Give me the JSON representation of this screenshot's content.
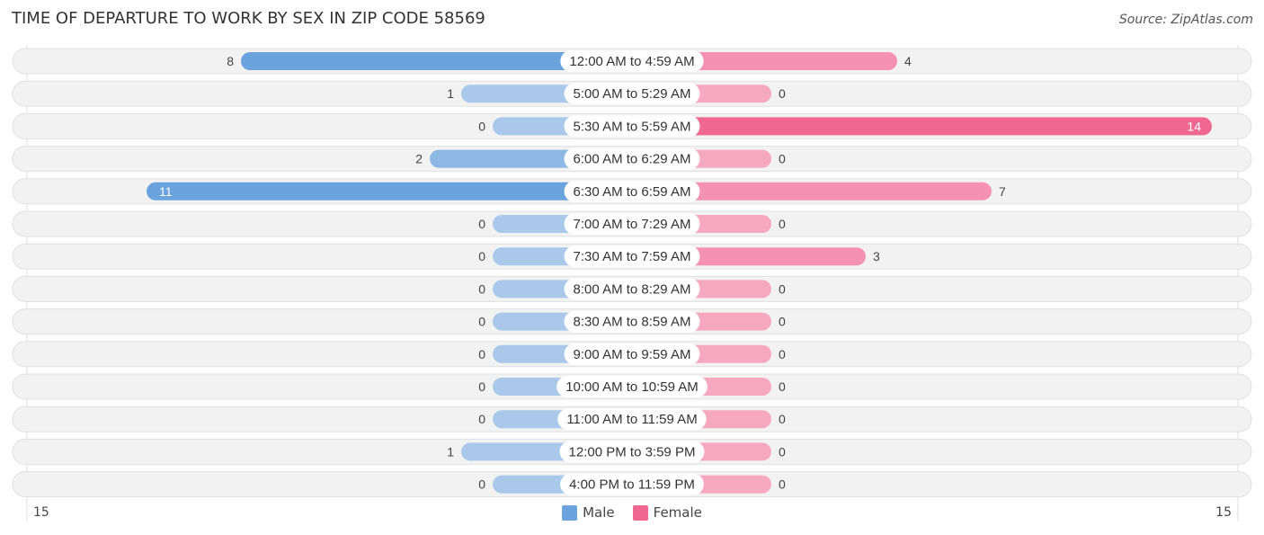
{
  "title": "TIME OF DEPARTURE TO WORK BY SEX IN ZIP CODE 58569",
  "source": "Source: ZipAtlas.com",
  "colors": {
    "male_strong": "#6aa3dd",
    "male_light": "#a9c8ea",
    "female_strong": "#f06892",
    "female_light": "#f7a8c1",
    "row_bg": "#f2f2f2"
  },
  "legend": [
    {
      "label": "Male",
      "color": "#6aa3dd"
    },
    {
      "label": "Female",
      "color": "#f06892"
    }
  ],
  "axis": {
    "left_label": "15",
    "right_label": "15"
  },
  "chart_data": {
    "type": "bar",
    "orientation": "horizontal-diverging",
    "title": "TIME OF DEPARTURE TO WORK BY SEX IN ZIP CODE 58569",
    "categories": [
      "12:00 AM to 4:59 AM",
      "5:00 AM to 5:29 AM",
      "5:30 AM to 5:59 AM",
      "6:00 AM to 6:29 AM",
      "6:30 AM to 6:59 AM",
      "7:00 AM to 7:29 AM",
      "7:30 AM to 7:59 AM",
      "8:00 AM to 8:29 AM",
      "8:30 AM to 8:59 AM",
      "9:00 AM to 9:59 AM",
      "10:00 AM to 10:59 AM",
      "11:00 AM to 11:59 AM",
      "12:00 PM to 3:59 PM",
      "4:00 PM to 11:59 PM"
    ],
    "series": [
      {
        "name": "Male",
        "values": [
          8,
          1,
          0,
          2,
          11,
          0,
          0,
          0,
          0,
          0,
          0,
          0,
          1,
          0
        ]
      },
      {
        "name": "Female",
        "values": [
          4,
          0,
          14,
          0,
          7,
          0,
          3,
          0,
          0,
          0,
          0,
          0,
          0,
          0
        ]
      }
    ],
    "xlim": [
      -15,
      15
    ],
    "xtick_labels": [
      "15",
      "15"
    ],
    "legend_position": "bottom-center",
    "grid": false
  }
}
